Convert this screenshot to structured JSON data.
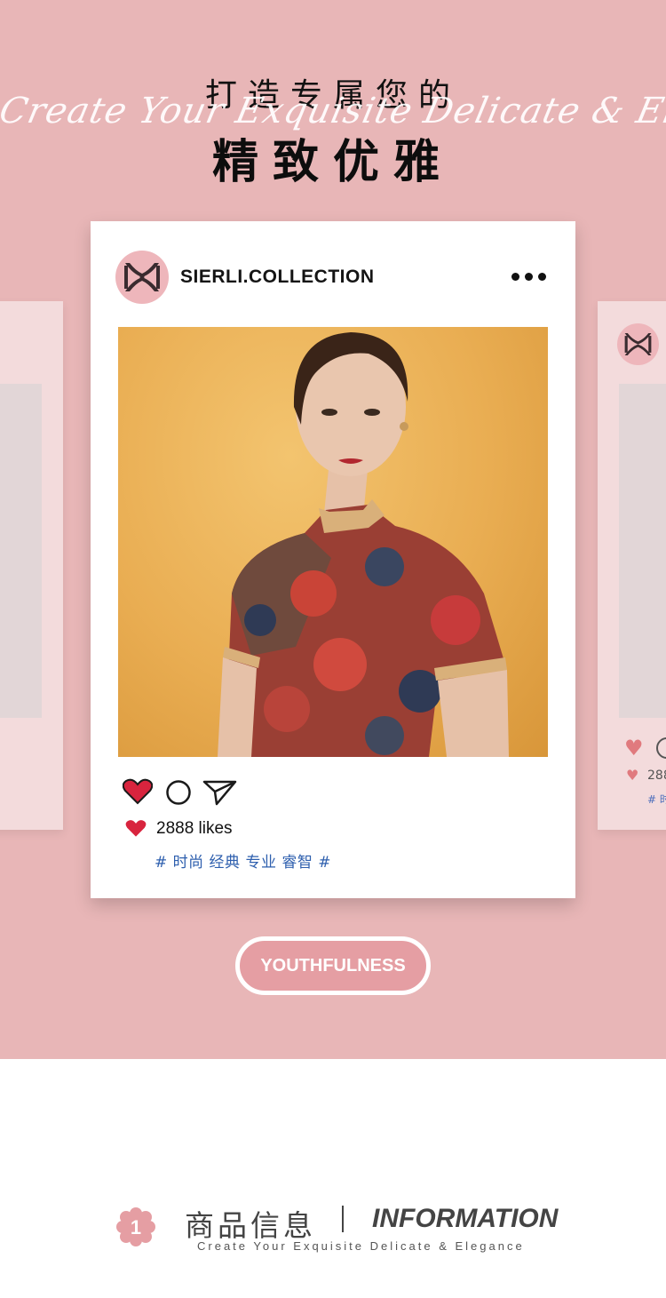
{
  "hero": {
    "headline_line1": "打造专属您的",
    "script_tagline": "Create Your Exquisite Delicate & Elegance",
    "headline_line2": "精致优雅",
    "background_color": "#e8b6b7"
  },
  "post": {
    "username": "SIERLI.COLLECTION",
    "likes_text": "2888 likes",
    "tags_text": "# 时尚 经典 专业 睿智 #",
    "icons": [
      "logo-monogram-icon",
      "more-dots-icon",
      "heart-icon",
      "comment-icon",
      "share-icon",
      "heart-small-icon"
    ],
    "heart_color": "#d8243e"
  },
  "side_card_right": {
    "likes_text": "288",
    "tags_text": "# 时"
  },
  "pill": {
    "label": "YOUTHFULNESS"
  },
  "section": {
    "badge_number": "1",
    "title_cn": "商品信息",
    "title_en": "INFORMATION",
    "subtitle": "Create Your Exquisite Delicate & Elegance",
    "accent_color": "#e59ea3"
  }
}
